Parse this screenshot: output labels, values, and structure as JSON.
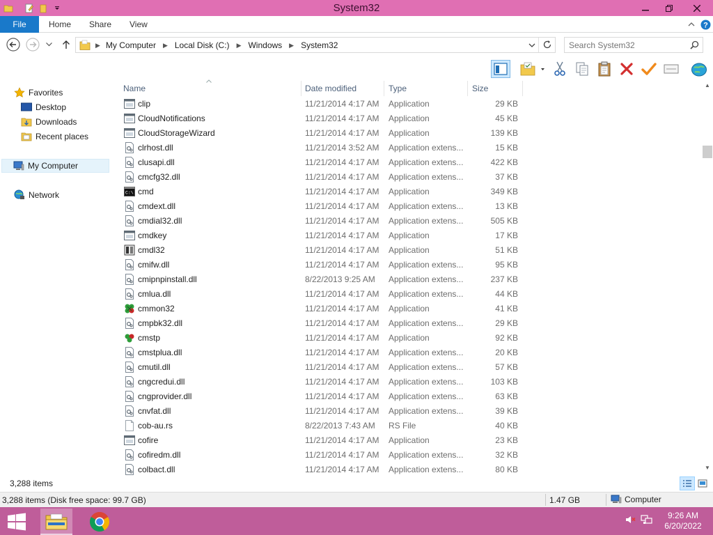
{
  "window": {
    "title": "System32",
    "controls": {
      "minimize": "—",
      "maximize": "❐",
      "close": "✕"
    }
  },
  "ribbon": {
    "tabs": [
      {
        "label": "File"
      },
      {
        "label": "Home"
      },
      {
        "label": "Share"
      },
      {
        "label": "View"
      }
    ],
    "collapse_icon": "chevron-up-icon",
    "help_icon": "help-icon"
  },
  "address": {
    "crumbs": [
      "My Computer",
      "Local Disk (C:)",
      "Windows",
      "System32"
    ],
    "search_placeholder": "Search System32"
  },
  "nav": {
    "favorites": "Favorites",
    "desktop": "Desktop",
    "downloads": "Downloads",
    "recent": "Recent places",
    "computer": "My Computer",
    "network": "Network"
  },
  "columns": {
    "name": "Name",
    "date": "Date modified",
    "type": "Type",
    "size": "Size"
  },
  "files": [
    {
      "icon": "app",
      "name": "clip",
      "date": "11/21/2014 4:17 AM",
      "type": "Application",
      "size": "29 KB"
    },
    {
      "icon": "app",
      "name": "CloudNotifications",
      "date": "11/21/2014 4:17 AM",
      "type": "Application",
      "size": "45 KB"
    },
    {
      "icon": "app",
      "name": "CloudStorageWizard",
      "date": "11/21/2014 4:17 AM",
      "type": "Application",
      "size": "139 KB"
    },
    {
      "icon": "dll",
      "name": "clrhost.dll",
      "date": "11/21/2014 3:52 AM",
      "type": "Application extens...",
      "size": "15 KB"
    },
    {
      "icon": "dll",
      "name": "clusapi.dll",
      "date": "11/21/2014 4:17 AM",
      "type": "Application extens...",
      "size": "422 KB"
    },
    {
      "icon": "dll",
      "name": "cmcfg32.dll",
      "date": "11/21/2014 4:17 AM",
      "type": "Application extens...",
      "size": "37 KB"
    },
    {
      "icon": "cmd",
      "name": "cmd",
      "date": "11/21/2014 4:17 AM",
      "type": "Application",
      "size": "349 KB"
    },
    {
      "icon": "dll",
      "name": "cmdext.dll",
      "date": "11/21/2014 4:17 AM",
      "type": "Application extens...",
      "size": "13 KB"
    },
    {
      "icon": "dll",
      "name": "cmdial32.dll",
      "date": "11/21/2014 4:17 AM",
      "type": "Application extens...",
      "size": "505 KB"
    },
    {
      "icon": "app",
      "name": "cmdkey",
      "date": "11/21/2014 4:17 AM",
      "type": "Application",
      "size": "17 KB"
    },
    {
      "icon": "cmdl",
      "name": "cmdl32",
      "date": "11/21/2014 4:17 AM",
      "type": "Application",
      "size": "51 KB"
    },
    {
      "icon": "dll",
      "name": "cmifw.dll",
      "date": "11/21/2014 4:17 AM",
      "type": "Application extens...",
      "size": "95 KB"
    },
    {
      "icon": "dll",
      "name": "cmipnpinstall.dll",
      "date": "8/22/2013 9:25 AM",
      "type": "Application extens...",
      "size": "237 KB"
    },
    {
      "icon": "dll",
      "name": "cmlua.dll",
      "date": "11/21/2014 4:17 AM",
      "type": "Application extens...",
      "size": "44 KB"
    },
    {
      "icon": "cmmon",
      "name": "cmmon32",
      "date": "11/21/2014 4:17 AM",
      "type": "Application",
      "size": "41 KB"
    },
    {
      "icon": "dll",
      "name": "cmpbk32.dll",
      "date": "11/21/2014 4:17 AM",
      "type": "Application extens...",
      "size": "29 KB"
    },
    {
      "icon": "cmstp",
      "name": "cmstp",
      "date": "11/21/2014 4:17 AM",
      "type": "Application",
      "size": "92 KB"
    },
    {
      "icon": "dll",
      "name": "cmstplua.dll",
      "date": "11/21/2014 4:17 AM",
      "type": "Application extens...",
      "size": "20 KB"
    },
    {
      "icon": "dll",
      "name": "cmutil.dll",
      "date": "11/21/2014 4:17 AM",
      "type": "Application extens...",
      "size": "57 KB"
    },
    {
      "icon": "dll",
      "name": "cngcredui.dll",
      "date": "11/21/2014 4:17 AM",
      "type": "Application extens...",
      "size": "103 KB"
    },
    {
      "icon": "dll",
      "name": "cngprovider.dll",
      "date": "11/21/2014 4:17 AM",
      "type": "Application extens...",
      "size": "63 KB"
    },
    {
      "icon": "dll",
      "name": "cnvfat.dll",
      "date": "11/21/2014 4:17 AM",
      "type": "Application extens...",
      "size": "39 KB"
    },
    {
      "icon": "file",
      "name": "cob-au.rs",
      "date": "8/22/2013 7:43 AM",
      "type": "RS File",
      "size": "40 KB"
    },
    {
      "icon": "app",
      "name": "cofire",
      "date": "11/21/2014 4:17 AM",
      "type": "Application",
      "size": "23 KB"
    },
    {
      "icon": "dll",
      "name": "cofiredm.dll",
      "date": "11/21/2014 4:17 AM",
      "type": "Application extens...",
      "size": "32 KB"
    },
    {
      "icon": "dll",
      "name": "colbact.dll",
      "date": "11/21/2014 4:17 AM",
      "type": "Application extens...",
      "size": "80 KB"
    }
  ],
  "status": {
    "items_count": "3,288 items",
    "disk_info": "3,288 items (Disk free space: 99.7 GB)",
    "size": "1.47 GB",
    "location": "Computer"
  },
  "taskbar": {
    "time": "9:26 AM",
    "date": "6/20/2022"
  },
  "colors": {
    "titlebar": "#e06fb3",
    "taskbar": "#bf5d9a",
    "file_tab": "#1979ca"
  }
}
